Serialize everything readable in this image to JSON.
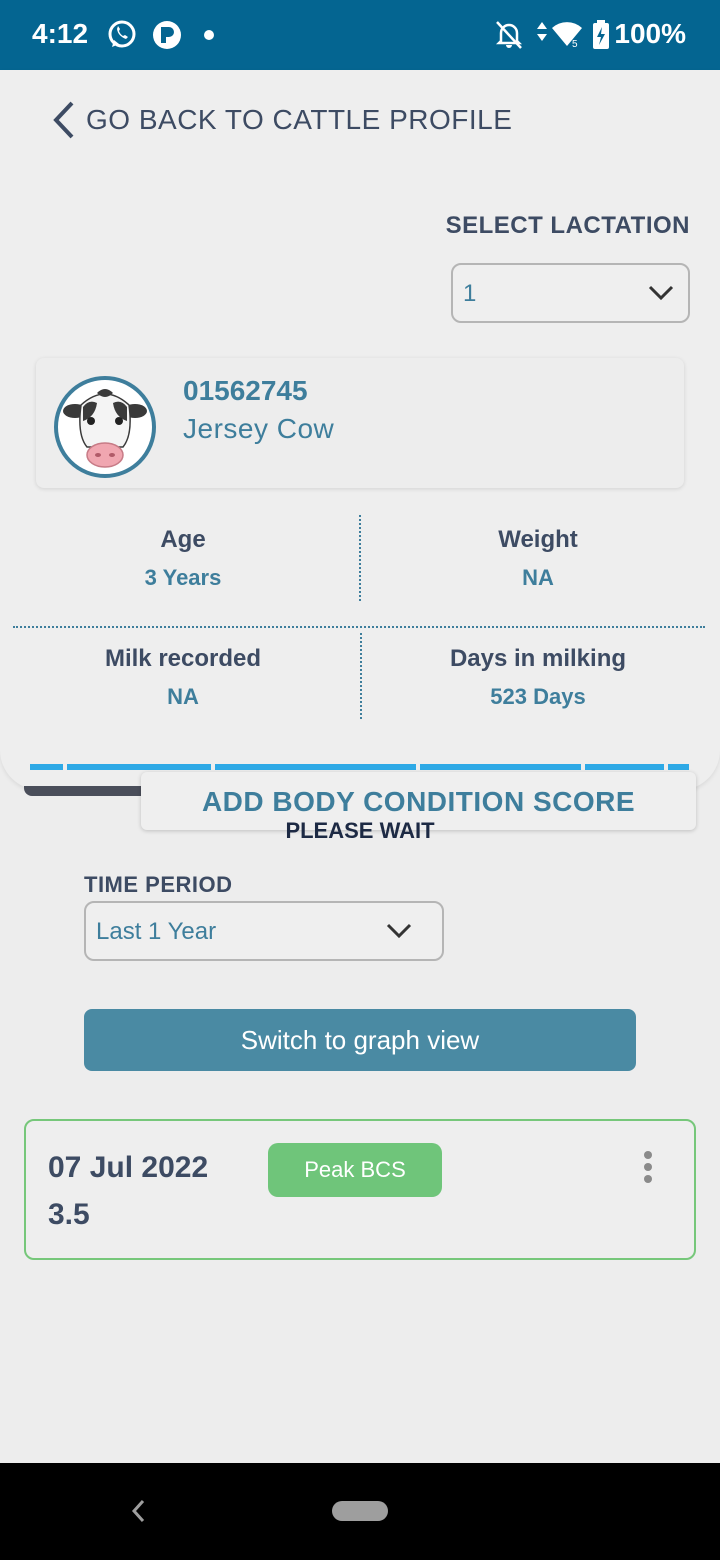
{
  "status_bar": {
    "time": "4:12",
    "battery": "100%",
    "icons": [
      "whatsapp-icon",
      "p-app-icon",
      "notification-dot-icon",
      "bell-off-icon",
      "data-arrows-icon",
      "wifi-icon",
      "battery-charging-icon"
    ]
  },
  "navigation": {
    "back_label": "GO BACK TO CATTLE PROFILE"
  },
  "lactation": {
    "title": "SELECT LACTATION",
    "selected": "1"
  },
  "cattle": {
    "id": "01562745",
    "breed": "Jersey  Cow"
  },
  "stats": {
    "age_label": "Age",
    "age_value": "3 Years",
    "weight_label": "Weight",
    "weight_value": "NA",
    "milk_label": "Milk recorded",
    "milk_value": "NA",
    "days_label": "Days in milking",
    "days_value": "523 Days"
  },
  "actions": {
    "add_bcs_label": "ADD BODY CONDITION SCORE",
    "please_wait": "PLEASE WAIT"
  },
  "time_period": {
    "title": "TIME PERIOD",
    "selected": "Last 1 Year"
  },
  "graph_button_label": "Switch to graph view",
  "records": [
    {
      "date": "07 Jul 2022",
      "score": "3.5",
      "badge": "Peak BCS"
    }
  ],
  "colors": {
    "status_bar": "#046591",
    "accent": "#3e7e9c",
    "button": "#4a8aa3",
    "badge": "#6fc57a",
    "progress": "#2ea9e6"
  }
}
